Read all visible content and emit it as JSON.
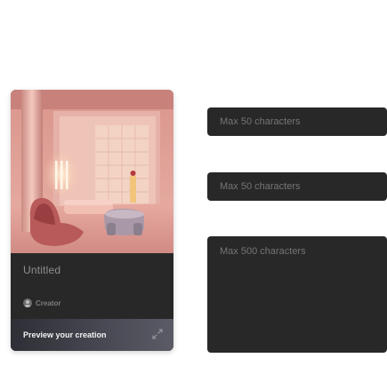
{
  "preview_card": {
    "title": "Untitled",
    "creator_label": "Creator",
    "preview_label": "Preview your creation"
  },
  "form": {
    "title_field": {
      "value": "",
      "placeholder": "Max 50 characters"
    },
    "subtitle_field": {
      "value": "",
      "placeholder": "Max 50 characters"
    },
    "description_field": {
      "value": "",
      "placeholder": "Max 500 characters"
    }
  },
  "icons": {
    "expand": "expand-icon",
    "creator_avatar": "user-avatar-icon"
  },
  "colors": {
    "card_background": "#282828",
    "field_background": "#282828",
    "placeholder_text": "#757575",
    "title_text": "#8f8f8f"
  }
}
